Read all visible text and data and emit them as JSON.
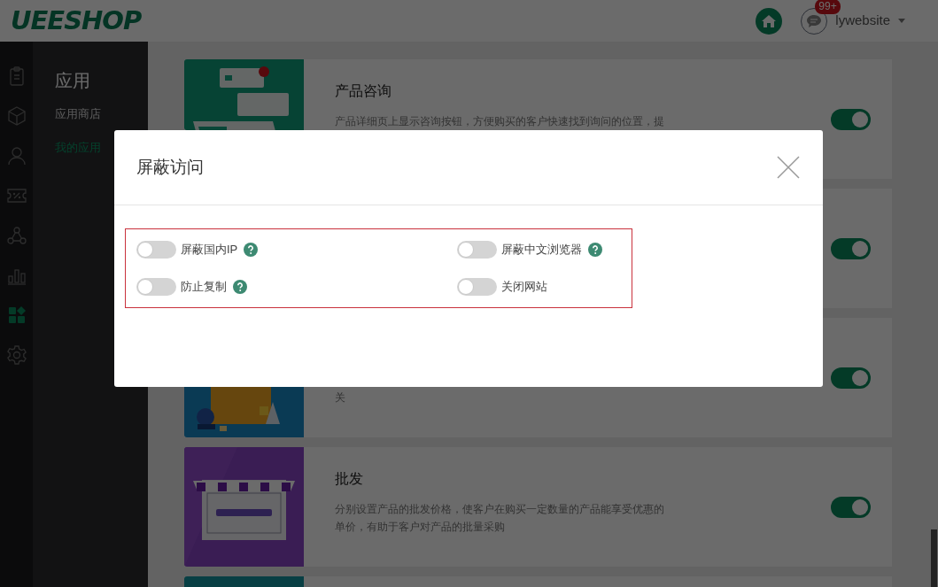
{
  "header": {
    "logo": "UEESHOP",
    "notification_badge": "99+",
    "username": "lywebsite"
  },
  "rail": [
    {
      "kind": "clipboard",
      "selected": false
    },
    {
      "kind": "cube",
      "selected": false
    },
    {
      "kind": "user",
      "selected": false
    },
    {
      "kind": "coupon",
      "selected": false
    },
    {
      "kind": "nodes",
      "selected": false
    },
    {
      "kind": "chart",
      "selected": false
    },
    {
      "kind": "apps",
      "selected": true
    },
    {
      "kind": "gear",
      "selected": false
    }
  ],
  "sidebar": {
    "title": "应用",
    "items": [
      {
        "label": "应用商店",
        "selected": false
      },
      {
        "label": "我的应用",
        "selected": true
      }
    ]
  },
  "apps": [
    {
      "image": {
        "kind": "picture"
      },
      "title": "产品咨询",
      "description": "产品详细页上显示咨询按钮，方便购买的客户快速找到询问的位置，提",
      "on": true
    },
    {
      "on": true
    },
    {
      "image": {
        "kind": "picture"
      },
      "description": "关",
      "continued": true,
      "on": true
    },
    {
      "image": {
        "kind": "picture"
      },
      "title": "批发",
      "description": "分别设置产品的批发价格，使客户在购买一定数量的产品能享受优惠的单价，有助于客户对产品的批量采购",
      "on": true
    },
    {
      "image": {
        "kind": "picture"
      }
    }
  ],
  "modal": {
    "title": "屏蔽访问",
    "options": [
      {
        "label": "屏蔽国内IP",
        "on": false,
        "help": true
      },
      {
        "label": "屏蔽中文浏览器",
        "on": false,
        "help": true
      },
      {
        "label": "防止复制",
        "on": false,
        "help": true
      },
      {
        "label": "关闭网站",
        "on": false,
        "help": false
      }
    ]
  }
}
